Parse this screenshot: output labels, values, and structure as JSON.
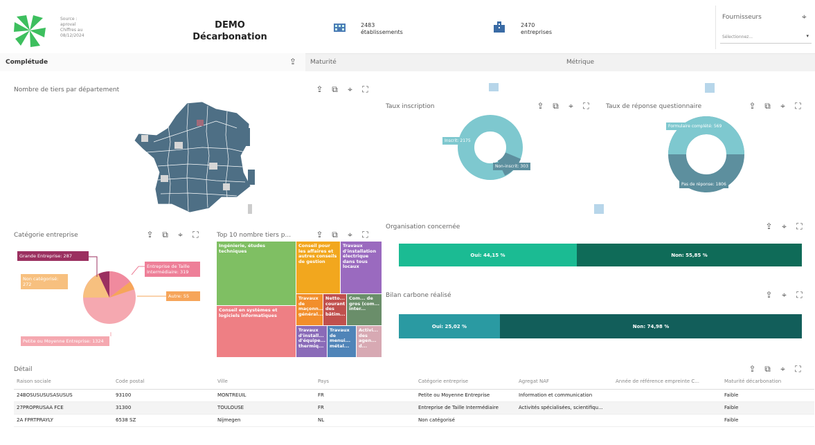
{
  "colors": {
    "brand_green": "#3dbf5e",
    "map_blue": "#4e6f85",
    "teal_light": "#7ec8cf",
    "teal_mid": "#5d8f9e",
    "green_bar": "#1bbb93",
    "dark_green": "#0f6b58",
    "bilan_teal": "#2a9aa2",
    "bilan_dark": "#125e5a"
  },
  "header": {
    "source_line1": "Source :",
    "source_line2": "aproval",
    "source_line3": "Chiffres au",
    "source_line4": "08/12/2024",
    "title_line1": "DEMO",
    "title_line2": "Décarbonation",
    "kpi1_value": "2483",
    "kpi1_label": "établissements",
    "kpi2_value": "2470",
    "kpi2_label": "entreprises",
    "filter_label": "Fournisseurs",
    "filter_placeholder": "Sélectionnez..."
  },
  "tabs": {
    "completude": "Complétude",
    "maturite": "Maturité",
    "metrique": "Métrique"
  },
  "cards": {
    "map_title": "Nombre de tiers par département",
    "inscription_title": "Taux inscription",
    "reponse_title": "Taux de réponse questionnaire",
    "categorie_title": "Catégorie entreprise",
    "top10_title": "Top 10 nombre tiers p...",
    "organisation_title": "Organisation concernée",
    "bilan_title": "Bilan carbone réalisé",
    "detail_title": "Détail"
  },
  "chart_data": [
    {
      "type": "pie",
      "title": "Taux inscription",
      "slices": [
        {
          "label": "Inscrit",
          "value": 2175
        },
        {
          "label": "Non-inscrit",
          "value": 303
        }
      ],
      "labels": [
        "Inscrit: 2175",
        "Non-inscrit: 303"
      ]
    },
    {
      "type": "pie",
      "title": "Taux de réponse questionnaire",
      "slices": [
        {
          "label": "Formulaire complété",
          "value": 569
        },
        {
          "label": "Pas de réponse",
          "value": 1806
        }
      ],
      "labels": [
        "Formulaire complété: 569",
        "Pas de réponse: 1806"
      ]
    },
    {
      "type": "pie",
      "title": "Catégorie entreprise",
      "slices": [
        {
          "label": "Grande Entreprise",
          "value": 287
        },
        {
          "label": "Entreprise de Taille Intermédiaire",
          "value": 319
        },
        {
          "label": "Autre",
          "value": 55
        },
        {
          "label": "Petite ou Moyenne Entreprise",
          "value": 1324
        },
        {
          "label": "Non catégorisé",
          "value": 272
        }
      ],
      "labels": [
        "Grande Entreprise: 287",
        "Entreprise de Taille Intermédiaire: 319",
        "Autre: 55",
        "Petite ou Moyenne Entreprise: 1324",
        "Non catégorisé: 272"
      ]
    },
    {
      "type": "bar",
      "title": "Organisation concernée",
      "series": [
        {
          "name": "Oui",
          "value": 44.15
        },
        {
          "name": "Non",
          "value": 55.85
        }
      ],
      "labels": [
        "Oui: 44,15 %",
        "Non: 55,85 %"
      ]
    },
    {
      "type": "bar",
      "title": "Bilan carbone réalisé",
      "series": [
        {
          "name": "Oui",
          "value": 25.02
        },
        {
          "name": "Non",
          "value": 74.98
        }
      ],
      "labels": [
        "Oui: 25,02 %",
        "Non: 74,98 %"
      ]
    }
  ],
  "treemap": [
    "Ingénierie, études techniques",
    "Conseil pour les affaires et autres conseils de gestion",
    "Travaux d'installation électrique dans tous locaux",
    "Conseil en systèmes et logiciels informatiques",
    "Travaux de maçonn... général...",
    "Netto... courant des bâtim...",
    "Com... de gros (com... inter...",
    "Travaux d'install... d'équipe... thermiq...",
    "Travaux de menui... métal...",
    "Activi... des agen... d..."
  ],
  "table": {
    "columns": [
      "Raison sociale",
      "Code postal",
      "Ville",
      "Pays",
      "Catégorie entreprise",
      "Agregat NAF",
      "Année de référence empreinte C...",
      "Maturité décarbonation"
    ],
    "rows": [
      [
        "24BOSUSUSUSASUSUS",
        "93100",
        "MONTREUIL",
        "FR",
        "Petite ou Moyenne Entreprise",
        "Information et communication",
        "",
        "Faible"
      ],
      [
        "27PROPRUSAA FCE",
        "31300",
        "TOULOUSE",
        "FR",
        "Entreprise de Taille Intermédiaire",
        "Activités spécialisées, scientifiqu...",
        "",
        "Faible"
      ],
      [
        "2A FPRTPRAYLY",
        "6538 SZ",
        "Nijmegen",
        "NL",
        "Non catégorisé",
        "",
        "",
        "Faible"
      ]
    ]
  }
}
